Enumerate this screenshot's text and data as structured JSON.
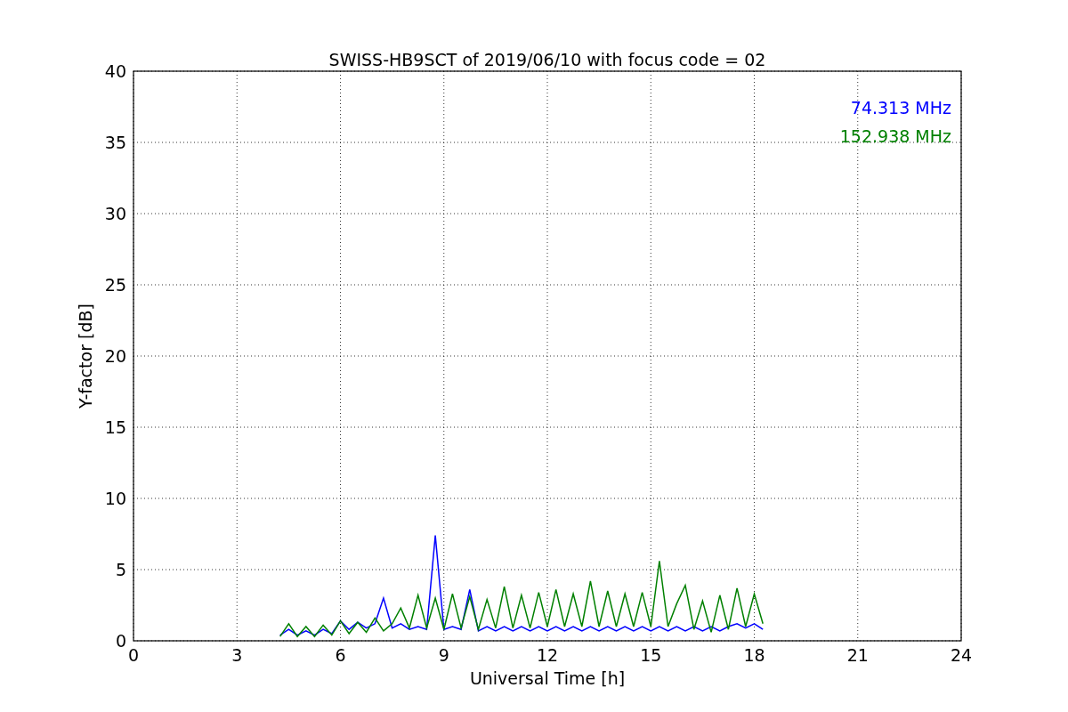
{
  "chart_data": {
    "type": "line",
    "title": "SWISS-HB9SCT of 2019/06/10 with focus code = 02",
    "xlabel": "Universal Time [h]",
    "ylabel": "Y-factor [dB]",
    "xlim": [
      0,
      24
    ],
    "ylim": [
      0,
      40
    ],
    "xticks": [
      0,
      3,
      6,
      9,
      12,
      15,
      18,
      21,
      24
    ],
    "yticks": [
      0,
      5,
      10,
      15,
      20,
      25,
      30,
      35,
      40
    ],
    "grid": true,
    "x": [
      4.25,
      4.5,
      4.75,
      5.0,
      5.25,
      5.5,
      5.75,
      6.0,
      6.25,
      6.5,
      6.75,
      7.0,
      7.25,
      7.5,
      7.75,
      8.0,
      8.25,
      8.5,
      8.75,
      9.0,
      9.25,
      9.5,
      9.75,
      10.0,
      10.25,
      10.5,
      10.75,
      11.0,
      11.25,
      11.5,
      11.75,
      12.0,
      12.25,
      12.5,
      12.75,
      13.0,
      13.25,
      13.5,
      13.75,
      14.0,
      14.25,
      14.5,
      14.75,
      15.0,
      15.25,
      15.5,
      15.75,
      16.0,
      16.25,
      16.5,
      16.75,
      17.0,
      17.25,
      17.5,
      17.75,
      18.0,
      18.25
    ],
    "series": [
      {
        "name": "74.313 MHz",
        "color": "#0000ff",
        "values": [
          0.4,
          0.8,
          0.4,
          0.7,
          0.4,
          0.8,
          0.5,
          1.4,
          0.8,
          1.3,
          0.9,
          1.2,
          3.0,
          0.9,
          1.2,
          0.8,
          1.0,
          0.8,
          7.4,
          0.8,
          1.0,
          0.8,
          3.6,
          0.7,
          1.0,
          0.7,
          1.0,
          0.7,
          1.0,
          0.7,
          1.0,
          0.7,
          1.0,
          0.7,
          1.0,
          0.7,
          1.0,
          0.7,
          1.0,
          0.7,
          1.0,
          0.7,
          1.0,
          0.7,
          1.0,
          0.7,
          1.0,
          0.7,
          1.0,
          0.7,
          1.0,
          0.7,
          1.0,
          1.2,
          0.9,
          1.2,
          0.8
        ]
      },
      {
        "name": "152.938 MHz",
        "color": "#008000",
        "values": [
          0.3,
          1.2,
          0.3,
          1.0,
          0.3,
          1.1,
          0.4,
          1.4,
          0.5,
          1.3,
          0.6,
          1.6,
          0.7,
          1.2,
          2.3,
          0.9,
          3.2,
          0.9,
          3.0,
          0.8,
          3.3,
          0.9,
          3.1,
          0.8,
          2.9,
          0.9,
          3.8,
          0.9,
          3.2,
          0.9,
          3.4,
          1.0,
          3.6,
          1.0,
          3.3,
          1.0,
          4.2,
          1.0,
          3.5,
          1.0,
          3.3,
          1.0,
          3.4,
          1.0,
          5.6,
          1.0,
          2.6,
          3.9,
          0.8,
          2.8,
          0.6,
          3.2,
          0.8,
          3.7,
          1.0,
          3.3,
          1.2
        ]
      }
    ]
  }
}
